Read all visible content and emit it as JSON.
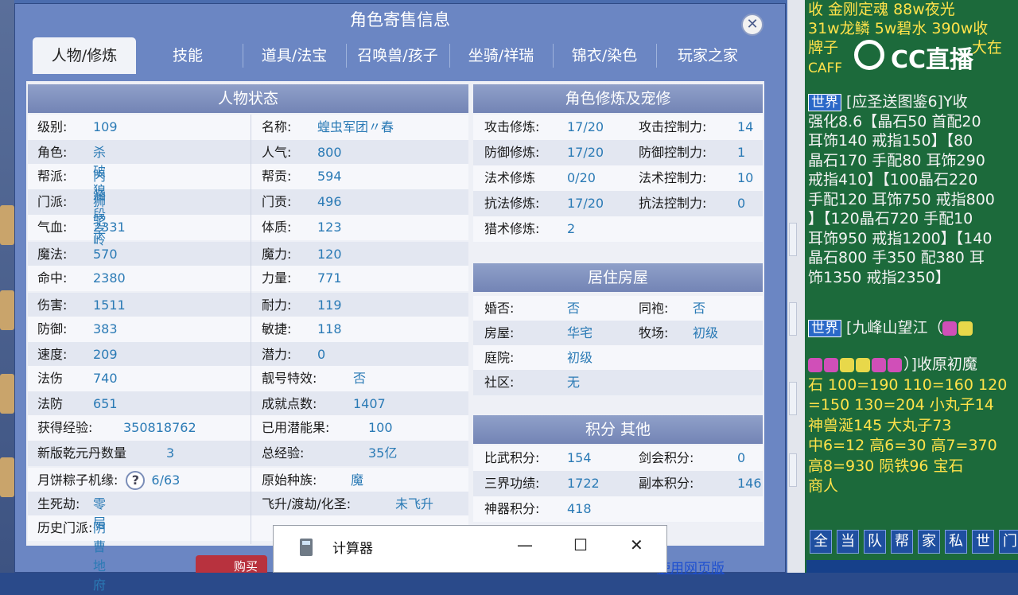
{
  "window": {
    "title": "角色寄售信息"
  },
  "tabs": [
    "人物/修炼",
    "技能",
    "道具/法宝",
    "召唤兽/孩子",
    "坐骑/祥瑞",
    "锦衣/染色",
    "玩家之家"
  ],
  "status_panel": {
    "heading": "人物状态",
    "left_rows": [
      {
        "label": "级别:",
        "value": "109"
      },
      {
        "label": "角色:",
        "value": "杀破狼"
      },
      {
        "label": "帮派:",
        "value": "内涵段子"
      },
      {
        "label": "门派:",
        "value": "狮驼岭"
      },
      {
        "label": "气血:",
        "value": "2331"
      },
      {
        "label": "魔法:",
        "value": "570"
      },
      {
        "label": "命中:",
        "value": "2380"
      },
      {
        "label": "伤害:",
        "value": "1511"
      },
      {
        "label": "防御:",
        "value": "383"
      },
      {
        "label": "速度:",
        "value": "209"
      },
      {
        "label": "法伤",
        "value": "740"
      },
      {
        "label": "法防",
        "value": "651"
      },
      {
        "label": "获得经验:",
        "value": "350818762"
      },
      {
        "label": "新版乾元丹数量",
        "value": "3"
      },
      {
        "label": "月饼粽子机缘:",
        "value": "6/63"
      },
      {
        "label": "生死劫:",
        "value": "零层"
      },
      {
        "label": "历史门派:",
        "value": "阴曹地府"
      }
    ],
    "right_rows": [
      {
        "label": "名称:",
        "value": "蝗虫军团〃春"
      },
      {
        "label": "人气:",
        "value": "800"
      },
      {
        "label": "帮贡:",
        "value": "594"
      },
      {
        "label": "门贡:",
        "value": "496"
      },
      {
        "label": "体质:",
        "value": "123"
      },
      {
        "label": "魔力:",
        "value": "120"
      },
      {
        "label": "力量:",
        "value": "771"
      },
      {
        "label": "耐力:",
        "value": "119"
      },
      {
        "label": "敏捷:",
        "value": "118"
      },
      {
        "label": "潜力:",
        "value": "0"
      },
      {
        "label": "靓号特效:",
        "value": "否"
      },
      {
        "label": "成就点数:",
        "value": "1407"
      },
      {
        "label": "已用潜能果:",
        "value": "100"
      },
      {
        "label": "总经验:",
        "value": "35亿"
      },
      {
        "label": "原始种族:",
        "value": "魔"
      },
      {
        "label": "飞升/渡劫/化圣:",
        "value": "未飞升"
      }
    ],
    "help_icon": "?"
  },
  "cultivation_panel": {
    "heading": "角色修炼及宠修",
    "rows": [
      {
        "l1": "攻击修炼:",
        "v1": "17/20",
        "l2": "攻击控制力:",
        "v2": "14"
      },
      {
        "l1": "防御修炼:",
        "v1": "17/20",
        "l2": "防御控制力:",
        "v2": "1"
      },
      {
        "l1": "法术修炼",
        "v1": "0/20",
        "l2": "法术控制力:",
        "v2": "10"
      },
      {
        "l1": "抗法修炼:",
        "v1": "17/20",
        "l2": "抗法控制力:",
        "v2": "0"
      },
      {
        "l1": "猎术修炼:",
        "v1": "2",
        "l2": "",
        "v2": ""
      }
    ]
  },
  "house_panel": {
    "heading": "居住房屋",
    "rows": [
      {
        "l1": "婚否:",
        "v1": "否",
        "l2": "同袍:",
        "v2": "否"
      },
      {
        "l1": "房屋:",
        "v1": "华宅",
        "l2": "牧场:",
        "v2": "初级"
      },
      {
        "l1": "庭院:",
        "v1": "初级",
        "l2": "",
        "v2": ""
      },
      {
        "l1": "社区:",
        "v1": "无",
        "l2": "",
        "v2": ""
      }
    ]
  },
  "score_panel": {
    "heading": "积分 其他",
    "rows": [
      {
        "l1": "比武积分:",
        "v1": "154",
        "l2": "剑会积分:",
        "v2": "0"
      },
      {
        "l1": "三界功绩:",
        "v1": "1722",
        "l2": "副本积分:",
        "v2": "146"
      },
      {
        "l1": "神器积分:",
        "v1": "418",
        "l2": "",
        "v2": ""
      }
    ]
  },
  "buy_button": "购买",
  "web_link": "使用网页版",
  "calculator": {
    "title": "计算器",
    "minimize": "—",
    "maximize": "☐",
    "close": "✕"
  },
  "chat": {
    "logo_text": "CC直播",
    "line1": "收 金刚定魂  88w夜光",
    "line2": "31w龙鳞  5w碧水  390w收",
    "line3": "牌子",
    "line3b": "大在",
    "line4": "CAFF",
    "channel_world": "世界",
    "msg1": [
      "[应圣送图鉴6]Y收",
      "强化8.6【晶石50  首配20",
      " 耳饰140 戒指150】【80",
      "晶石170 手配80 耳饰290",
      "戒指410】【100晶石220",
      "手配120 耳饰750 戒指800",
      "】【120晶石720 手配10",
      "耳饰950 戒指1200】【140",
      "晶石800 手350 配380 耳",
      "饰1350 戒指2350】"
    ],
    "msg2_head": "[九峰山望江（",
    "msg2": [
      "）]收原初魔",
      "石  100=190 110=160 120",
      "=150 130=204  小丸子14",
      " 神兽涎145  大丸子73",
      "  中6=12 高6=30 高7=370",
      "  高8=930  陨铁96  宝石",
      "商人"
    ]
  },
  "chat_buttons": [
    "全",
    "当",
    "队",
    "帮",
    "家",
    "私",
    "世",
    "门"
  ],
  "colors": {
    "window_bg": "#6b86c3",
    "panel_head": "#7f90c0",
    "value_text": "#2a7ab5",
    "chat_bg": "#1c6a3b",
    "chat_text": "#ffe24a"
  }
}
